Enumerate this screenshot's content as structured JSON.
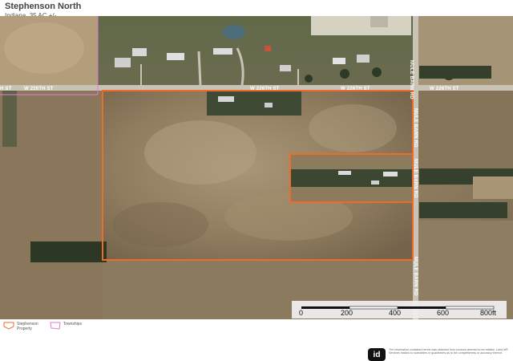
{
  "title": "Stephenson North",
  "subtitle": "Indiana,  35 AC +/-",
  "roads": {
    "west_edge": "H ST",
    "w226_left": "W 226TH ST",
    "w226_center": "W 226TH ST",
    "w226_right": "W 226TH ST",
    "w226_top_mid": "W 226TH ST",
    "mule_top": "MULE BARN RD",
    "mule_mid": "MULE BARN RD",
    "mule_right": "MULE BARN RD",
    "mule_bottom": "MULE BARN RD"
  },
  "scale": {
    "labels": [
      "0",
      "200",
      "400",
      "600",
      "800ft"
    ]
  },
  "legend": [
    {
      "icon": "property-boundary-icon",
      "label_line1": "Stephenson",
      "label_line2": "Property"
    },
    {
      "icon": "township-boundary-icon",
      "label_line1": "Townships",
      "label_line2": ""
    }
  ],
  "logo": {
    "text": "id"
  },
  "disclaimer": "The information contained herein was obtained from sources deemed to be reliable. Land id® Services makes no warranties or guarantees as to the completeness or accuracy thereof.",
  "colors": {
    "property_outline": "#f06a2a",
    "township_line": "#e27bd0",
    "field": "#8f7c5f",
    "road": "#c9c3b5"
  }
}
